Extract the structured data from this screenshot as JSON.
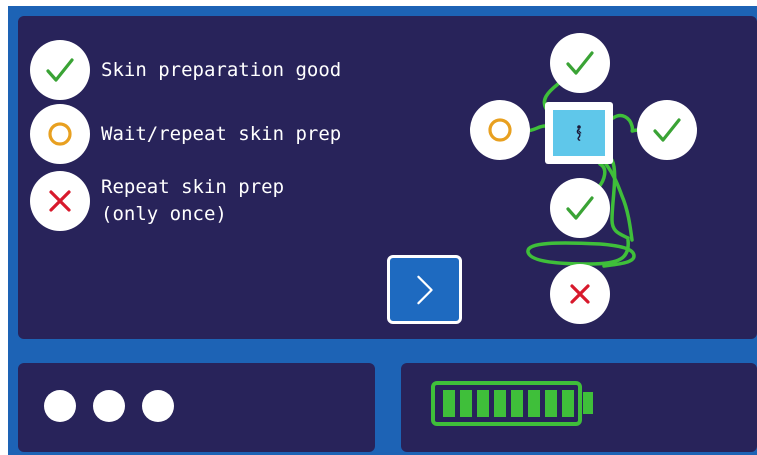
{
  "legend": {
    "items": [
      {
        "status": "good",
        "icon": "check-icon",
        "text": "Skin preparation good"
      },
      {
        "status": "wait",
        "icon": "ring-icon",
        "text": "Wait/repeat skin prep"
      },
      {
        "status": "repeat",
        "icon": "cross-icon",
        "text_line1": "Repeat skin prep",
        "text_line2": "(only once)"
      }
    ]
  },
  "electrodes": {
    "top": "good",
    "left": "wait",
    "right": "good",
    "lower": "good",
    "bottom": "repeat"
  },
  "footer": {
    "dots": 3,
    "battery_segments": 8,
    "battery_level": 1.0
  },
  "colors": {
    "background_panel": "#28235a",
    "frame_blue": "#1d63b5",
    "check_green": "#3aa335",
    "ring_orange": "#e8a020",
    "cross_red": "#d8192c",
    "wire_green": "#3fbf3a",
    "device_blue": "#5fc7ea"
  }
}
